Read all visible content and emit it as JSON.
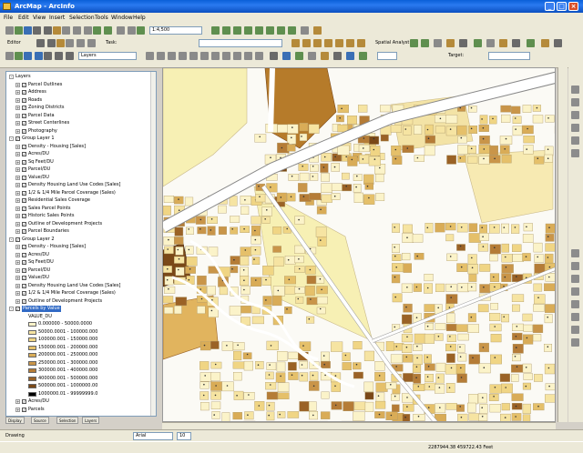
{
  "window": {
    "title": "ArcMap - ArcInfo",
    "minimize": "_",
    "maximize": "□",
    "close": "×"
  },
  "menu": [
    "File",
    "Edit",
    "View",
    "Insert",
    "Selection",
    "Tools",
    "Window",
    "Help"
  ],
  "toolbar": {
    "scale_value": "1:4,500",
    "editor_label": "Editor",
    "task_label": "Task:",
    "target_label": "Target:",
    "layer_combo": "Layers",
    "spatial_analyst": "Spatial Analyst"
  },
  "toc": {
    "items": [
      {
        "depth": 0,
        "expander": "-",
        "label": "Layers",
        "swatch": ""
      },
      {
        "depth": 1,
        "expander": "+",
        "checked": true,
        "label": "Parcel Outlines",
        "swatch": ""
      },
      {
        "depth": 1,
        "expander": "+",
        "checked": true,
        "label": "Address",
        "swatch": ""
      },
      {
        "depth": 1,
        "expander": "+",
        "checked": true,
        "label": "Roads",
        "swatch": ""
      },
      {
        "depth": 1,
        "expander": "+",
        "checked": true,
        "label": "Zoning Districts",
        "swatch": ""
      },
      {
        "depth": 1,
        "expander": "+",
        "checked": true,
        "label": "Parcel Data",
        "swatch": ""
      },
      {
        "depth": 1,
        "expander": "+",
        "checked": true,
        "label": "Street Centerlines",
        "swatch": ""
      },
      {
        "depth": 1,
        "expander": "+",
        "checked": true,
        "label": "Photography",
        "swatch": ""
      },
      {
        "depth": 0,
        "expander": "-",
        "checked": true,
        "label": "Group Layer 1",
        "swatch": ""
      },
      {
        "depth": 1,
        "expander": "+",
        "checked": true,
        "label": "Density - Housing [Sales]",
        "swatch": ""
      },
      {
        "depth": 1,
        "expander": "+",
        "checked": true,
        "label": "Acres/DU",
        "swatch": ""
      },
      {
        "depth": 1,
        "expander": "+",
        "checked": true,
        "label": "Sq Feet/DU",
        "swatch": ""
      },
      {
        "depth": 1,
        "expander": "+",
        "checked": true,
        "label": "Parcel/DU",
        "swatch": ""
      },
      {
        "depth": 1,
        "expander": "+",
        "checked": true,
        "label": "Value/DU",
        "swatch": ""
      },
      {
        "depth": 1,
        "expander": "+",
        "checked": true,
        "label": "Density Housing Land Use Codes [Sales]",
        "swatch": ""
      },
      {
        "depth": 1,
        "expander": "+",
        "checked": true,
        "label": "1/2 & 1/4 Mile Parcel Coverage (Sales)",
        "swatch": ""
      },
      {
        "depth": 1,
        "expander": "+",
        "checked": true,
        "label": "Residential Sales Coverage",
        "swatch": ""
      },
      {
        "depth": 1,
        "expander": "+",
        "checked": true,
        "label": "Sales Parcel Points",
        "swatch": ""
      },
      {
        "depth": 1,
        "expander": "+",
        "checked": true,
        "label": "Historic Sales Points",
        "swatch": ""
      },
      {
        "depth": 1,
        "expander": "+",
        "checked": true,
        "label": "Outline of Development Projects",
        "swatch": ""
      },
      {
        "depth": 1,
        "expander": "+",
        "checked": true,
        "label": "Parcel Boundaries",
        "swatch": ""
      },
      {
        "depth": 0,
        "expander": "-",
        "checked": true,
        "label": "Group Layer 2",
        "swatch": ""
      },
      {
        "depth": 1,
        "expander": "+",
        "checked": true,
        "label": "Density - Housing [Sales]",
        "swatch": ""
      },
      {
        "depth": 1,
        "expander": "+",
        "checked": true,
        "label": "Acres/DU",
        "swatch": ""
      },
      {
        "depth": 1,
        "expander": "+",
        "checked": true,
        "label": "Sq Feet/DU",
        "swatch": ""
      },
      {
        "depth": 1,
        "expander": "+",
        "checked": true,
        "label": "Parcel/DU",
        "swatch": ""
      },
      {
        "depth": 1,
        "expander": "+",
        "checked": true,
        "label": "Value/DU",
        "swatch": ""
      },
      {
        "depth": 1,
        "expander": "+",
        "checked": true,
        "label": "Density Housing Land Use Codes [Sales]",
        "swatch": ""
      },
      {
        "depth": 1,
        "expander": "+",
        "checked": true,
        "label": "1/2 & 1/4 Mile Parcel Coverage (Sales)",
        "swatch": ""
      },
      {
        "depth": 1,
        "expander": "+",
        "checked": true,
        "label": "Outline of Development Projects",
        "swatch": ""
      },
      {
        "depth": 0,
        "expander": "-",
        "checked": true,
        "label": "Parcels by Value",
        "swatch": "",
        "selected": true
      },
      {
        "depth": 2,
        "expander": "",
        "label": "VALUE_DU",
        "swatch": ""
      },
      {
        "depth": 2,
        "expander": "",
        "label": "0.000000 - 50000.0000",
        "swatch": "#fbf3c9"
      },
      {
        "depth": 2,
        "expander": "",
        "label": "50000.0001 - 100000.000",
        "swatch": "#f6e4a2"
      },
      {
        "depth": 2,
        "expander": "",
        "label": "100000.001 - 150000.000",
        "swatch": "#f0d584"
      },
      {
        "depth": 2,
        "expander": "",
        "label": "150000.001 - 200000.000",
        "swatch": "#e5c06a"
      },
      {
        "depth": 2,
        "expander": "",
        "label": "200000.001 - 250000.000",
        "swatch": "#d9ac57"
      },
      {
        "depth": 2,
        "expander": "",
        "label": "250000.001 - 300000.000",
        "swatch": "#c99549"
      },
      {
        "depth": 2,
        "expander": "",
        "label": "300000.001 - 400000.000",
        "swatch": "#b57c37"
      },
      {
        "depth": 2,
        "expander": "",
        "label": "400000.001 - 500000.000",
        "swatch": "#9a6226"
      },
      {
        "depth": 2,
        "expander": "",
        "label": "500000.001 - 1000000.00",
        "swatch": "#7a4818"
      },
      {
        "depth": 2,
        "expander": "",
        "label": "1000000.01 - 99999999.0",
        "swatch": "#000000"
      },
      {
        "depth": 1,
        "expander": "+",
        "checked": true,
        "label": "Acres/DU",
        "swatch": ""
      },
      {
        "depth": 1,
        "expander": "+",
        "checked": true,
        "label": "Parcels",
        "swatch": ""
      }
    ]
  },
  "toc_tabs": [
    "Display",
    "Source",
    "Selection",
    "Layers"
  ],
  "drawing": {
    "label": "Drawing",
    "font": "Arial",
    "size": "10"
  },
  "status": {
    "coords": "2287944.38  459722.43 Feet"
  },
  "colors": {
    "parcel_classes": [
      "#fbf3c9",
      "#f6e4a2",
      "#f0d584",
      "#e5c06a",
      "#d9ac57",
      "#c99549",
      "#b57c37",
      "#9a6226",
      "#7a4818"
    ],
    "road": "#ffffff",
    "map_bg": "#fbfaf5"
  }
}
